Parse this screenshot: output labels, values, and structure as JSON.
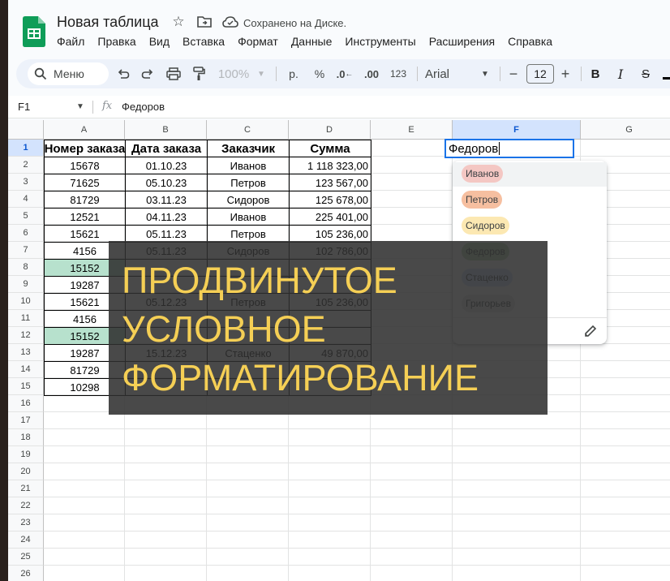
{
  "app": {
    "doc_title": "Новая таблица",
    "saved_status": "Сохранено на Диске.",
    "menu": [
      "Файл",
      "Правка",
      "Вид",
      "Вставка",
      "Формат",
      "Данные",
      "Инструменты",
      "Расширения",
      "Справка"
    ]
  },
  "toolbar": {
    "search_label": "Меню",
    "zoom": "100%",
    "currency": "р.",
    "percent": "%",
    "dec_decrease": ".0",
    "dec_increase": ".00",
    "number_format": "123",
    "font_name": "Arial",
    "font_size": "12"
  },
  "formula_bar": {
    "cell_ref": "F1",
    "fx": "fx",
    "value": "Федоров"
  },
  "sheet": {
    "columns": [
      "A",
      "B",
      "C",
      "D",
      "E",
      "F",
      "G"
    ],
    "selected_column": "F",
    "row_numbers": [
      "1",
      "2",
      "3",
      "4",
      "5",
      "6",
      "7",
      "8",
      "9",
      "10",
      "11",
      "12",
      "13",
      "14",
      "15",
      "16",
      "17",
      "18",
      "19",
      "20",
      "21",
      "22",
      "23",
      "24",
      "25",
      "26"
    ],
    "headers": [
      "Номер заказа",
      "Дата заказа",
      "Заказчик",
      "Сумма"
    ],
    "rows": [
      {
        "num": "15678",
        "date": "01.10.23",
        "client": "Иванов",
        "sum": "1 118 323,00",
        "highlight": false
      },
      {
        "num": "71625",
        "date": "05.10.23",
        "client": "Петров",
        "sum": "123 567,00",
        "highlight": false
      },
      {
        "num": "81729",
        "date": "03.11.23",
        "client": "Сидоров",
        "sum": "125 678,00",
        "highlight": false
      },
      {
        "num": "12521",
        "date": "04.11.23",
        "client": "Иванов",
        "sum": "225 401,00",
        "highlight": false
      },
      {
        "num": "15621",
        "date": "05.11.23",
        "client": "Петров",
        "sum": "105 236,00",
        "highlight": false
      },
      {
        "num": "4156",
        "date": "05.11.23",
        "client": "Сидоров",
        "sum": "102 786,00",
        "highlight": false
      },
      {
        "num": "15152",
        "date": "",
        "client": "",
        "sum": "",
        "highlight": true
      },
      {
        "num": "19287",
        "date": "",
        "client": "",
        "sum": "",
        "highlight": false
      },
      {
        "num": "15621",
        "date": "05.12.23",
        "client": "Петров",
        "sum": "105 236,00",
        "highlight": false
      },
      {
        "num": "4156",
        "date": "",
        "client": "",
        "sum": "",
        "highlight": false
      },
      {
        "num": "15152",
        "date": "",
        "client": "",
        "sum": "",
        "highlight": true
      },
      {
        "num": "19287",
        "date": "15.12.23",
        "client": "Стаценко",
        "sum": "49 870,00",
        "highlight": false
      },
      {
        "num": "81729",
        "date": "",
        "client": "",
        "sum": "",
        "highlight": false
      },
      {
        "num": "10298",
        "date": "",
        "client": "",
        "sum": "",
        "highlight": false
      }
    ],
    "active_cell_value": "Федоров"
  },
  "dropdown": {
    "options": [
      {
        "label": "Иванов",
        "bg": "#f4c7c3",
        "color": "#3c4043"
      },
      {
        "label": "Петров",
        "bg": "#f6bfa0",
        "color": "#3c4043"
      },
      {
        "label": "Сидоров",
        "bg": "#fce8b2",
        "color": "#3c4043"
      },
      {
        "label": "Федоров",
        "bg": "#b7d7a8",
        "color": "#3c4043"
      },
      {
        "label": "Стаценко",
        "bg": "#c9daf8",
        "color": "#3c4043"
      },
      {
        "label": "Григорьев",
        "bg": "#e0e0e0",
        "color": "#3c4043"
      }
    ]
  },
  "overlay": {
    "lines": [
      "ПРОДВИНУТОЕ",
      "УСЛОВНОЕ",
      "ФОРМАТИРОВАНИЕ"
    ],
    "text_color": "#f5cf55"
  }
}
